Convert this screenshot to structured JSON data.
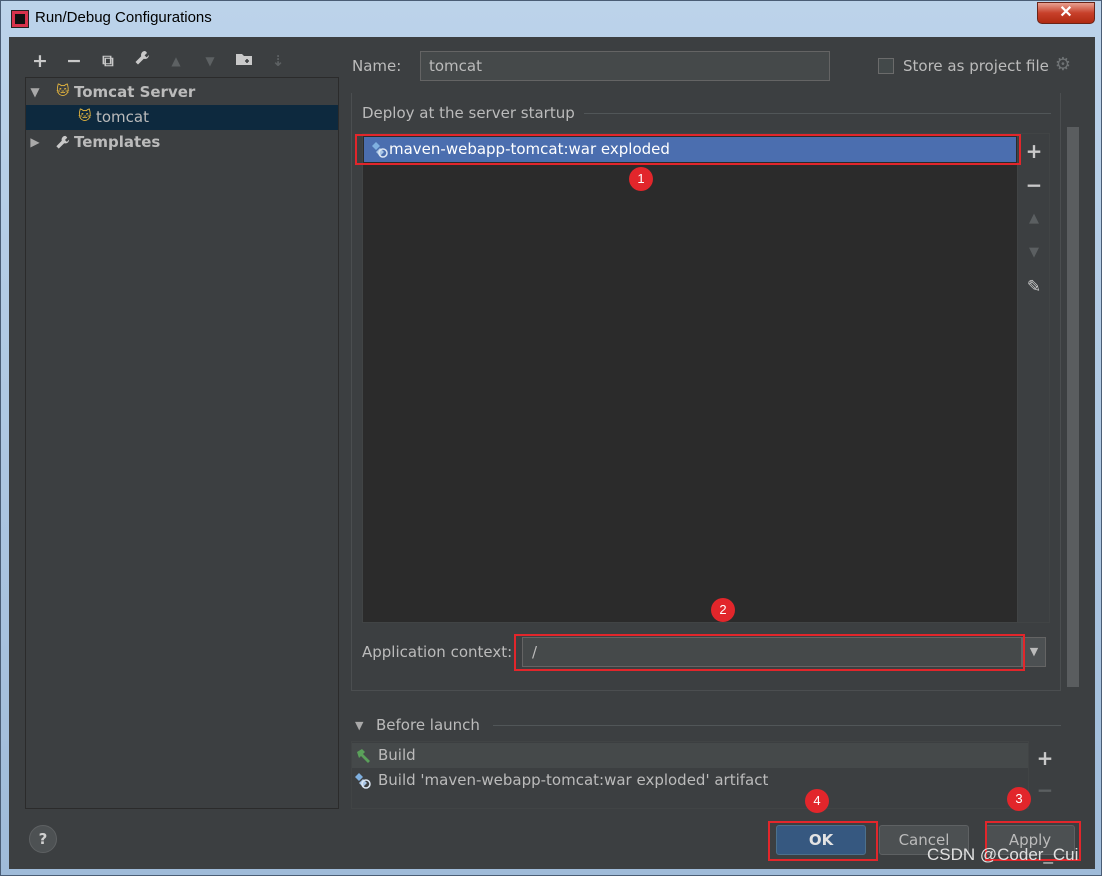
{
  "window": {
    "title": "Run/Debug Configurations",
    "close_glyph": "✕"
  },
  "left_toolbar": {
    "icons": [
      "add-icon",
      "remove-icon",
      "copy-icon",
      "wrench-icon",
      "move-up-icon",
      "move-down-icon",
      "new-folder-icon",
      "sort-icon"
    ],
    "glyphs": [
      "+",
      "−",
      "⧉",
      "🔧",
      "▲",
      "▼",
      "▣",
      "⇣"
    ]
  },
  "tree": {
    "group": {
      "label": "Tomcat Server",
      "expanded": true
    },
    "child": {
      "label": "tomcat",
      "selected": true
    },
    "templates": {
      "label": "Templates",
      "expanded": false
    }
  },
  "form": {
    "name_label": "Name:",
    "name_value": "tomcat",
    "store_label": "Store as project file",
    "store_checked": false
  },
  "deploy": {
    "title": "Deploy at the server startup",
    "items": [
      "maven-webapp-tomcat:war exploded"
    ],
    "side_buttons": [
      "+",
      "−",
      "▲",
      "▼",
      "✎"
    ]
  },
  "context": {
    "label": "Application context:",
    "value": "/"
  },
  "before_launch": {
    "title": "Before launch",
    "items": [
      "Build",
      "Build 'maven-webapp-tomcat:war exploded' artifact"
    ],
    "side_buttons": [
      "+",
      "−"
    ]
  },
  "buttons": {
    "ok": "OK",
    "cancel": "Cancel",
    "apply": "Apply",
    "help": "?"
  },
  "annotations": [
    "1",
    "2",
    "3",
    "4"
  ],
  "watermark": "CSDN @Coder_Cui",
  "colors": {
    "accent_red": "#e2262b",
    "selection": "#4b6eaf",
    "background": "#3c3f41"
  }
}
